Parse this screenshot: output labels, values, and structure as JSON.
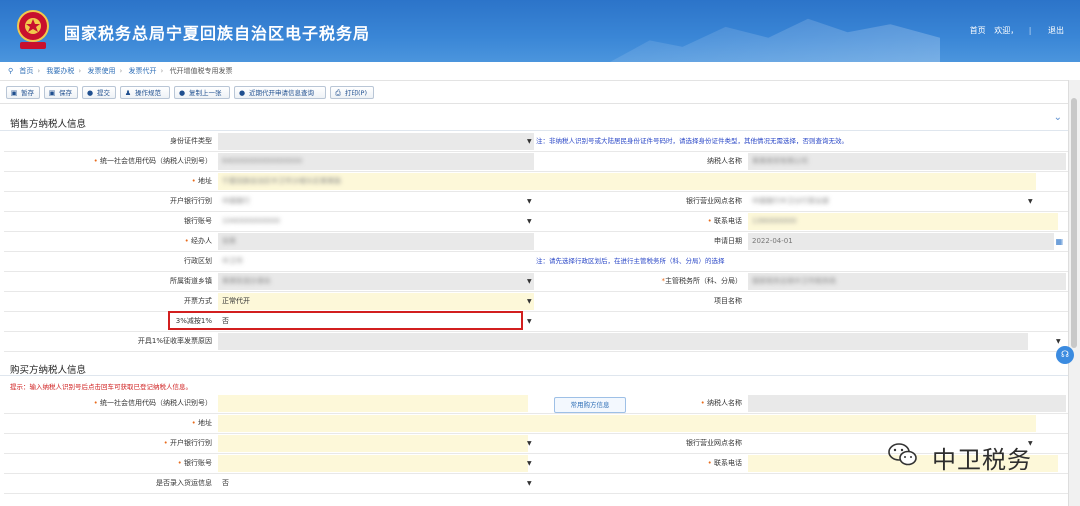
{
  "header": {
    "title": "国家税务总局宁夏回族自治区电子税务局",
    "links": [
      "首页",
      "欢迎，"
    ],
    "logout": "退出"
  },
  "breadcrumb": [
    "首页",
    "我要办税",
    "发票使用",
    "发票代开",
    "代开增值税专用发票"
  ],
  "toolbar": [
    {
      "label": "暂存",
      "icon": "save-draft-icon",
      "glyph": "▣"
    },
    {
      "label": "保存",
      "icon": "save-icon",
      "glyph": "▣"
    },
    {
      "label": "提交",
      "icon": "submit-icon",
      "glyph": "●"
    },
    {
      "label": "操作规范",
      "icon": "guide-icon",
      "glyph": "♟"
    },
    {
      "label": "复制上一张",
      "icon": "copy-icon",
      "glyph": "●"
    },
    {
      "label": "近期代开申请信息查询",
      "icon": "query-icon",
      "glyph": "●"
    },
    {
      "label": "打印(P)",
      "icon": "print-icon",
      "glyph": "⎙"
    }
  ],
  "seller": {
    "title": "销售方纳税人信息",
    "id_type_label": "身份证件类型",
    "id_type_note": "注：非纳税人识别号或大陆居民身份证件号码时，请选择身份证件类型，其他情况无需选择，否则查询无效。",
    "credit_code_label": "统一社会信用代码（纳税人识别号）",
    "credit_code_value": "640000000000000000",
    "name_label": "纳税人名称",
    "name_value": "某某商贸有限公司",
    "address_label": "地址",
    "address_value": "宁夏回族自治区中卫市沙坡头区某某路",
    "bank_label": "开户银行行别",
    "bank_value": "中国银行",
    "branch_label": "银行营业网点名称",
    "branch_value": "中国银行中卫分行营业部",
    "account_label": "银行账号",
    "account_value": "1040000000000",
    "phone_label": "联系电话",
    "phone_value": "1390000000",
    "agent_label": "经办人",
    "agent_value": "张某",
    "apply_date_label": "申请日期",
    "apply_date_value": "2022-04-01",
    "region_label": "行政区划",
    "region_value": "中卫市",
    "region_note": "注：请先选择行政区划后，在进行主管税务所（科、分局）的选择",
    "street_label": "所属街道乡镇",
    "street_value": "某某街道办事处",
    "tax_office_label": "主管税务所（科、分局）",
    "tax_office_value": "国家税务总局中卫市税务局",
    "invoice_mode_label": "开票方式",
    "invoice_mode_value": "正常代开",
    "project_label": "项目名称",
    "reduction_label": "3%减按1%",
    "reduction_value": "否",
    "reason_label": "开具1%征收率发票原因"
  },
  "buyer": {
    "title": "购买方纳税人信息",
    "tip": "提示：输入纳税人识别号后点击回车可获取已登记纳税人信息。",
    "credit_code_label": "统一社会信用代码（纳税人识别号）",
    "common_btn": "常用购方信息",
    "name_label": "纳税人名称",
    "address_label": "地址",
    "bank_label": "开户银行行别",
    "branch_label": "银行营业网点名称",
    "account_label": "银行账号",
    "phone_label": "联系电话",
    "shipping_label": "是否录入货运信息",
    "shipping_value": "否"
  },
  "watermark": "中卫税务",
  "colors": {
    "header": "#3a86d6",
    "required": "#e86a1a",
    "note": "#2b48c7",
    "highlight": "#d21f1f",
    "readonly": "#e9e9e9",
    "editable": "#fdf8d9"
  }
}
